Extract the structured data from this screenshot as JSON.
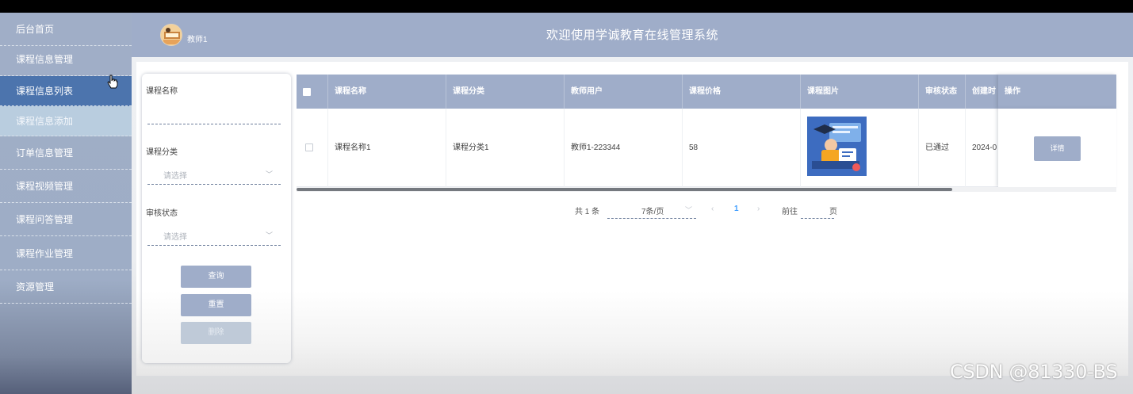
{
  "sidebar": {
    "items": [
      {
        "label": "后台首页"
      },
      {
        "label": "课程信息管理"
      },
      {
        "label": "课程信息列表"
      },
      {
        "label": "课程信息添加"
      },
      {
        "label": "订单信息管理"
      },
      {
        "label": "课程视频管理"
      },
      {
        "label": "课程问答管理"
      },
      {
        "label": "课程作业管理"
      },
      {
        "label": "资源管理"
      }
    ]
  },
  "header": {
    "username": "教师1",
    "title": "欢迎使用学诚教育在线管理系统"
  },
  "filter": {
    "course_name_label": "课程名称",
    "category_label": "课程分类",
    "category_placeholder": "请选择",
    "status_label": "审核状态",
    "status_placeholder": "请选择",
    "query_button": "查询",
    "reset_button": "重置",
    "delete_button": "删除"
  },
  "table": {
    "columns": [
      "课程名称",
      "课程分类",
      "教师用户",
      "课程价格",
      "课程图片",
      "审核状态",
      "创建时",
      "操作"
    ],
    "rows": [
      {
        "course_name": "课程名称1",
        "category": "课程分类1",
        "teacher": "教师1-223344",
        "price": "58",
        "status": "已通过",
        "created": "2024-0",
        "action": "详情"
      }
    ]
  },
  "pagination": {
    "total": "共 1 条",
    "page_size": "7条/页",
    "current_page": "1",
    "goto_label": "前往",
    "page_suffix": "页"
  },
  "watermark": "CSDN @81330-BS",
  "colors": {
    "accent": "#9fadc9",
    "active_nav": "#4c74ad",
    "sub_nav": "#b9cddf"
  }
}
